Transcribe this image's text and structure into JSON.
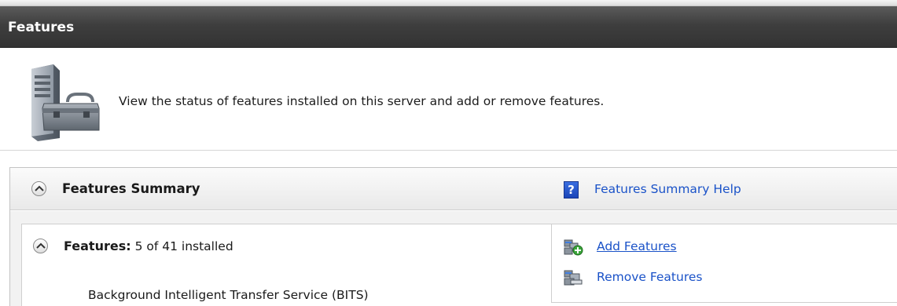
{
  "header": {
    "title": "Features"
  },
  "intro": {
    "description": "View the status of features installed on this server and add or remove features."
  },
  "summary": {
    "title": "Features Summary",
    "help_link": "Features Summary Help",
    "features_label": "Features:",
    "features_count": "5 of 41 installed",
    "installed_features": [
      "Background Intelligent Transfer Service (BITS)"
    ],
    "actions": {
      "add": "Add Features",
      "remove": "Remove Features"
    }
  },
  "icons": {
    "server": "server-toolbox-icon",
    "help": "help-icon",
    "add": "add-features-icon",
    "remove": "remove-features-icon",
    "collapse": "collapse-chevron-icon"
  },
  "colors": {
    "title_bar": "#3e3e3e",
    "link": "#1a52c8",
    "help_icon": "#2a5bd0"
  }
}
